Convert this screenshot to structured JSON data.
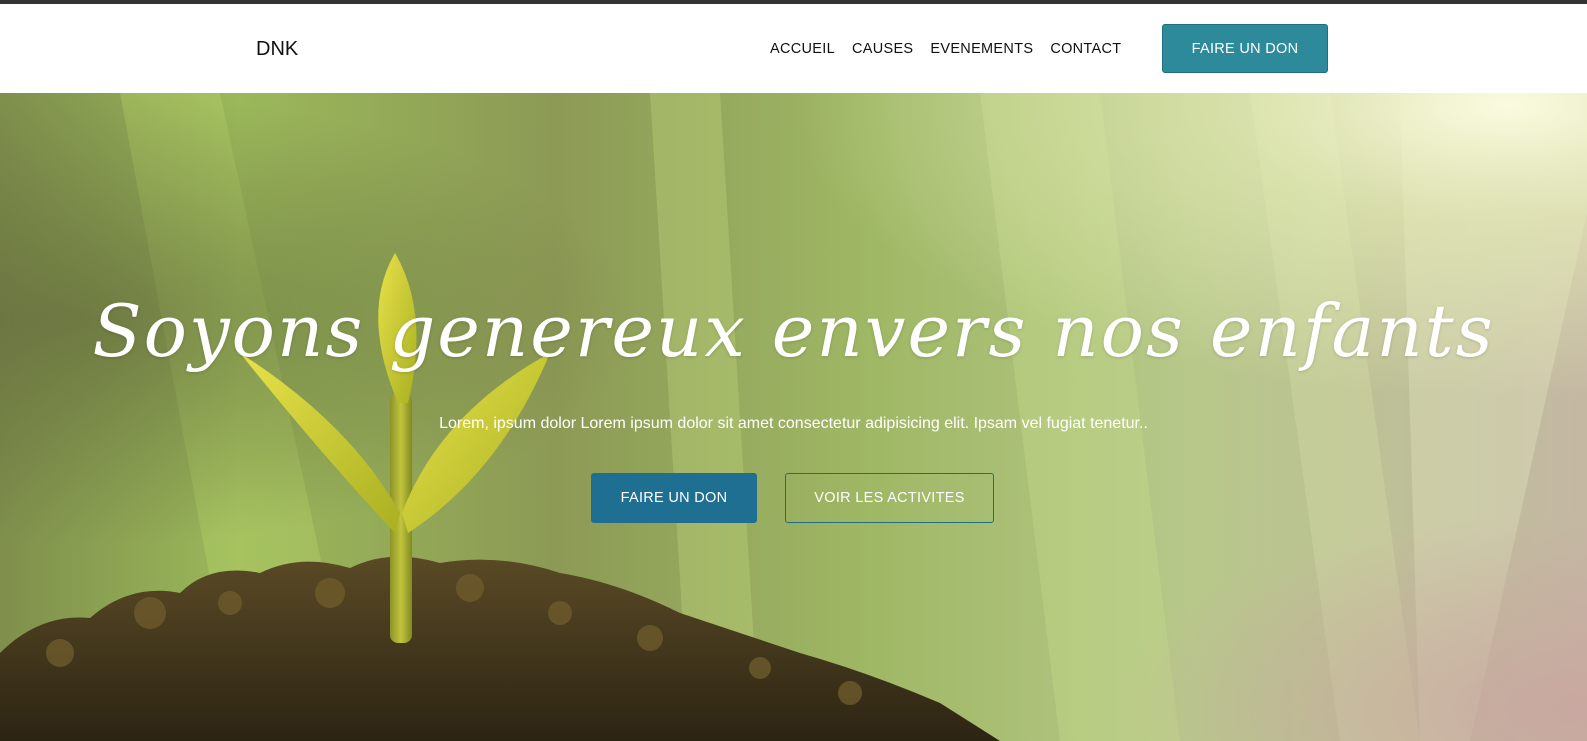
{
  "header": {
    "logo": "DNK",
    "nav": [
      "ACCUEIL",
      "CAUSES",
      "EVENEMENTS",
      "CONTACT"
    ],
    "donate_label": "FAIRE UN DON"
  },
  "hero": {
    "title": "Soyons genereux envers nos enfants",
    "subtitle": "Lorem, ipsum dolor Lorem ipsum dolor sit amet consectetur adipisicing elit. Ipsam vel fugiat tenetur..",
    "primary_button": "FAIRE UN DON",
    "secondary_button": "VOIR LES ACTIVITES",
    "image": "seedling-in-soil"
  },
  "colors": {
    "accent": "#2c8a9b",
    "primary_button": "#1f6f93",
    "topbar": "#333333"
  }
}
